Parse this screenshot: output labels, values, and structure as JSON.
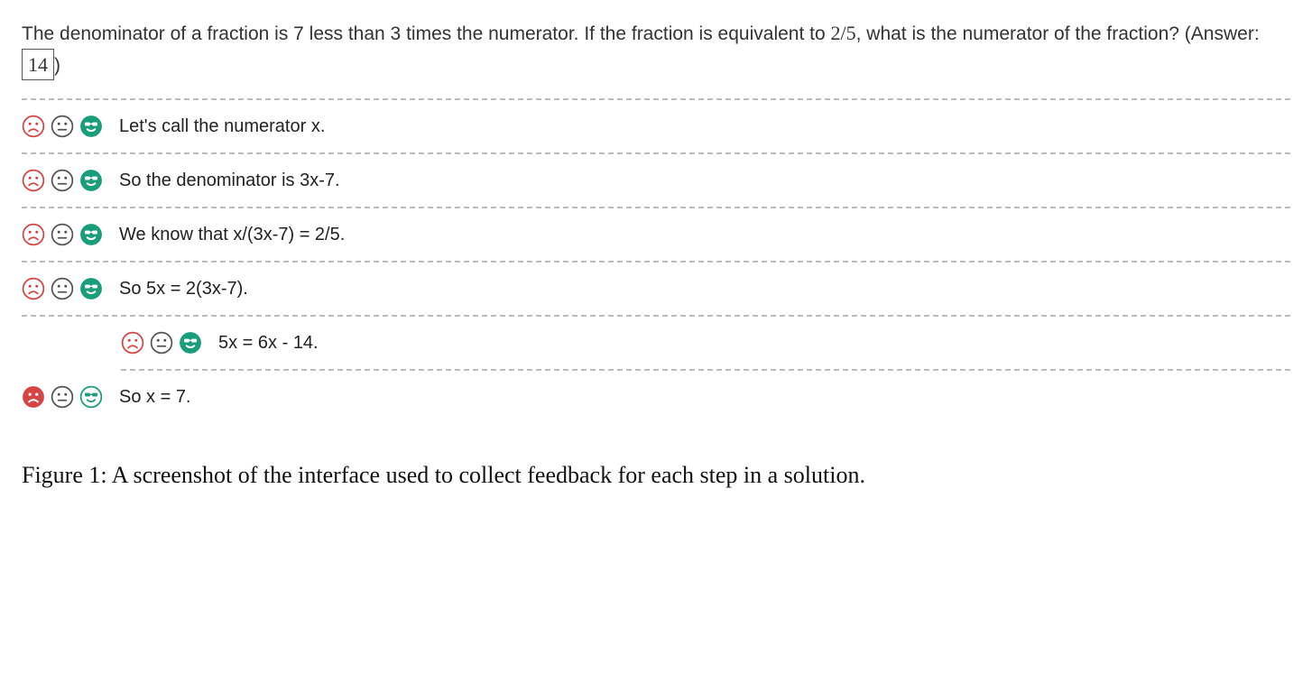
{
  "question": {
    "text_before_fraction": "The denominator of a fraction is 7 less than 3 times the numerator. If the fraction is equivalent to ",
    "fraction": "2/5",
    "text_after_fraction": ", what is the numerator of the fraction? (Answer: ",
    "answer_value": "14",
    "text_close": ")"
  },
  "rating_icons": {
    "sad": "sad-icon",
    "neutral": "neutral-icon",
    "happy": "cool-icon"
  },
  "steps": [
    {
      "text": "Let's call the numerator x.",
      "selected": "happy",
      "indent": 0
    },
    {
      "text": "So the denominator is 3x-7.",
      "selected": "happy",
      "indent": 0
    },
    {
      "text": "We know that x/(3x-7) = 2/5.",
      "selected": "happy",
      "indent": 0
    },
    {
      "text": "So 5x = 2(3x-7).",
      "selected": "happy",
      "indent": 0
    },
    {
      "text": "5x = 6x - 14.",
      "selected": "happy",
      "indent": 1
    },
    {
      "text": "So x = 7.",
      "selected": "sad",
      "indent": 0
    }
  ],
  "caption": "Figure 1: A screenshot of the interface used to collect feedback for each step in a solution."
}
